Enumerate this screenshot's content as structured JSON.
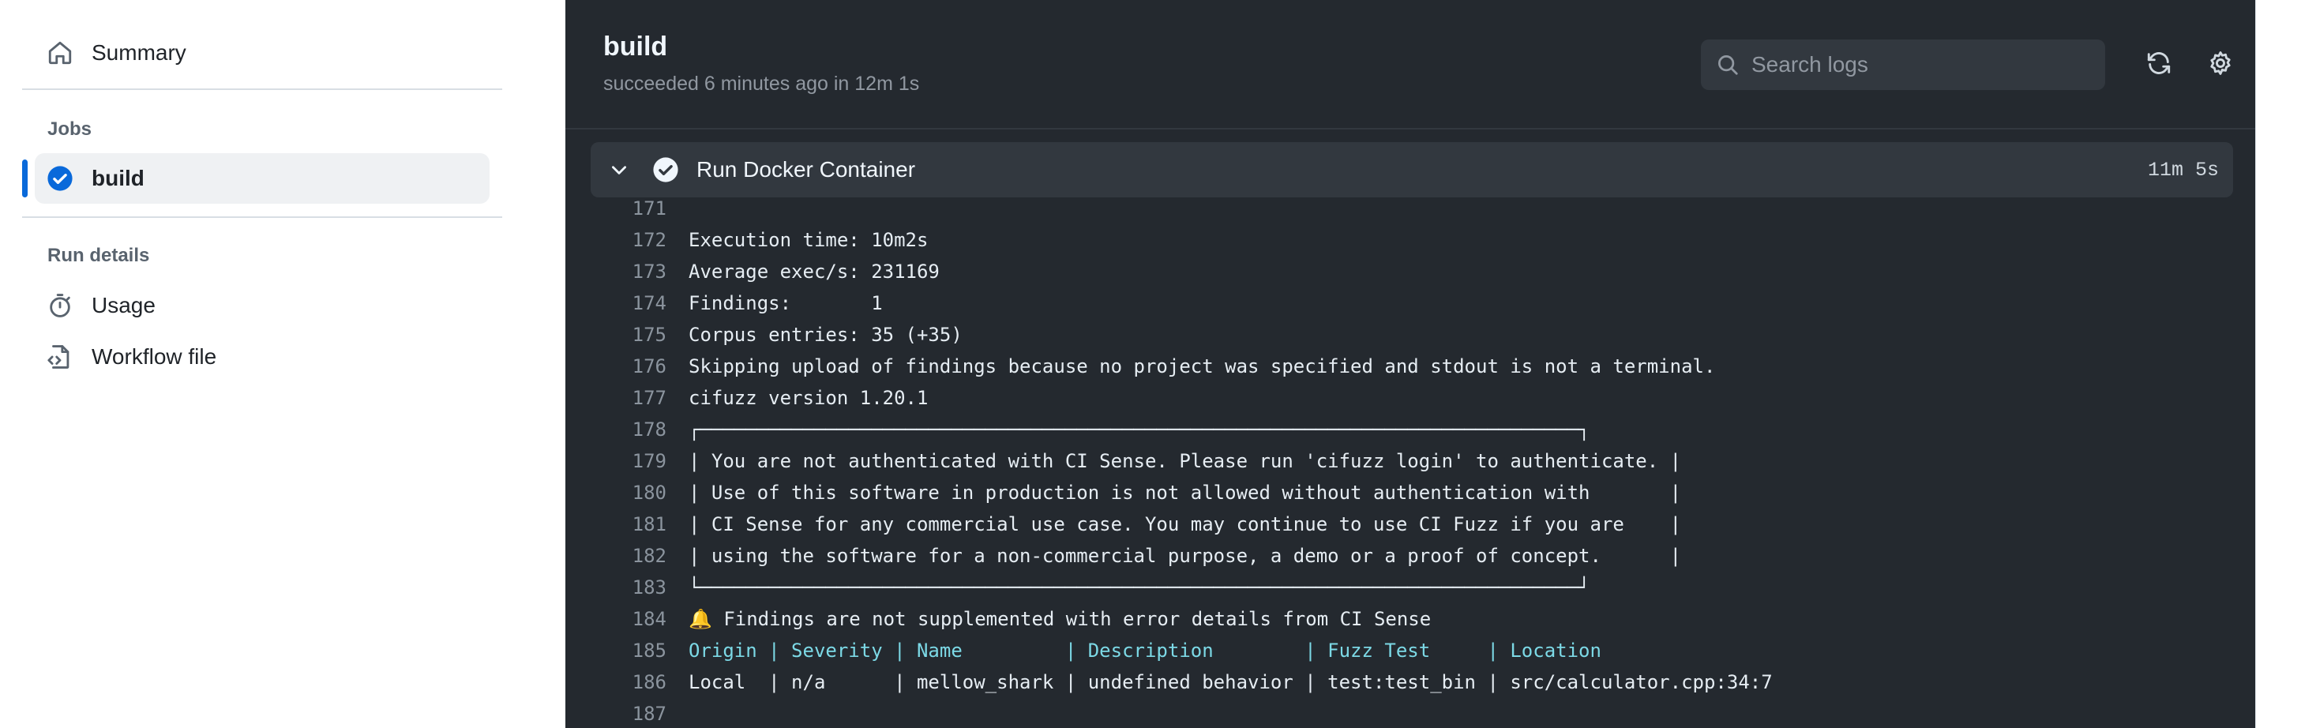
{
  "sidebar": {
    "summary_label": "Summary",
    "jobs_heading": "Jobs",
    "job_label": "build",
    "run_details_heading": "Run details",
    "usage_label": "Usage",
    "workflow_file_label": "Workflow file"
  },
  "header": {
    "title": "build",
    "subtitle": "succeeded 6 minutes ago in 12m 1s",
    "search_placeholder": "Search logs"
  },
  "step": {
    "name": "Run Docker Container",
    "duration": "11m 5s"
  },
  "log_lines": [
    {
      "num": "171",
      "text": ""
    },
    {
      "num": "172",
      "text": "Execution time: 10m2s"
    },
    {
      "num": "173",
      "text": "Average exec/s: 231169"
    },
    {
      "num": "174",
      "text": "Findings:       1"
    },
    {
      "num": "175",
      "text": "Corpus entries: 35 (+35)"
    },
    {
      "num": "176",
      "text": "Skipping upload of findings because no project was specified and stdout is not a terminal."
    },
    {
      "num": "177",
      "text": "cifuzz version 1.20.1"
    },
    {
      "num": "178",
      "text": "┌─────────────────────────────────────────────────────────────────────────────┐"
    },
    {
      "num": "179",
      "text": "| You are not authenticated with CI Sense. Please run 'cifuzz login' to authenticate. |"
    },
    {
      "num": "180",
      "text": "| Use of this software in production is not allowed without authentication with       |"
    },
    {
      "num": "181",
      "text": "| CI Sense for any commercial use case. You may continue to use CI Fuzz if you are    |"
    },
    {
      "num": "182",
      "text": "| using the software for a non-commercial purpose, a demo or a proof of concept.      |"
    },
    {
      "num": "183",
      "text": "└─────────────────────────────────────────────────────────────────────────────┘"
    },
    {
      "num": "184",
      "text": "🔔 Findings are not supplemented with error details from CI Sense"
    },
    {
      "num": "185",
      "text": "Origin | Severity | Name         | Description        | Fuzz Test     | Location"
    },
    {
      "num": "186",
      "text": "Local  | n/a      | mellow_shark | undefined behavior | test:test_bin | src/calculator.cpp:34:7"
    },
    {
      "num": "187",
      "text": ""
    }
  ],
  "colors": {
    "accent": "#0969da",
    "panel_bg": "#24292f",
    "header_row": "#7cd9e6"
  },
  "icons": {
    "summary": "home-icon",
    "job_status": "check-circle-icon",
    "usage": "stopwatch-icon",
    "workflow": "file-code-icon",
    "search": "search-icon",
    "refresh": "refresh-icon",
    "settings": "gear-icon",
    "collapse": "chevron-down-icon"
  }
}
